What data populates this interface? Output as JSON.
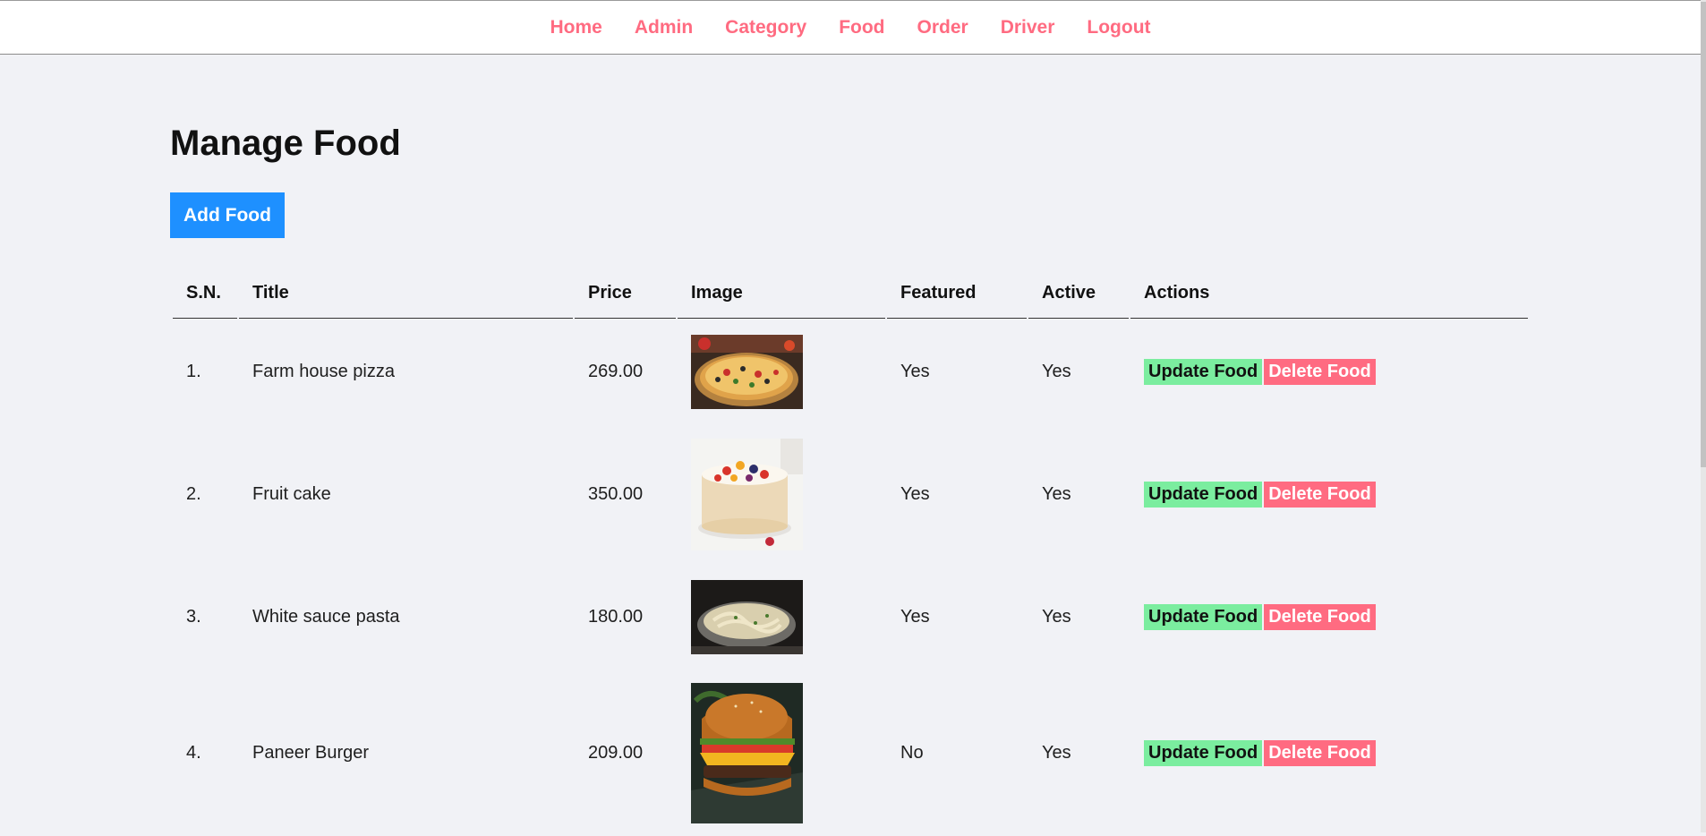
{
  "nav": {
    "items": [
      {
        "label": "Home"
      },
      {
        "label": "Admin"
      },
      {
        "label": "Category"
      },
      {
        "label": "Food"
      },
      {
        "label": "Order"
      },
      {
        "label": "Driver"
      },
      {
        "label": "Logout"
      }
    ]
  },
  "page": {
    "title": "Manage Food",
    "add_button": "Add Food"
  },
  "table": {
    "headers": [
      "S.N.",
      "Title",
      "Price",
      "Image",
      "Featured",
      "Active",
      "Actions"
    ],
    "rows": [
      {
        "sn": "1.",
        "title": "Farm house pizza",
        "price": "269.00",
        "image": "pizza",
        "featured": "Yes",
        "active": "Yes"
      },
      {
        "sn": "2.",
        "title": "Fruit cake",
        "price": "350.00",
        "image": "cake",
        "featured": "Yes",
        "active": "Yes"
      },
      {
        "sn": "3.",
        "title": "White sauce pasta",
        "price": "180.00",
        "image": "pasta",
        "featured": "Yes",
        "active": "Yes"
      },
      {
        "sn": "4.",
        "title": "Paneer Burger",
        "price": "209.00",
        "image": "burger",
        "featured": "No",
        "active": "Yes"
      }
    ],
    "update_label": "Update Food",
    "delete_label": "Delete Food"
  },
  "colors": {
    "nav_link": "#ff6b81",
    "primary": "#1e90ff",
    "update": "#7bed9f",
    "delete": "#ff6b81",
    "background": "#f1f2f6"
  }
}
